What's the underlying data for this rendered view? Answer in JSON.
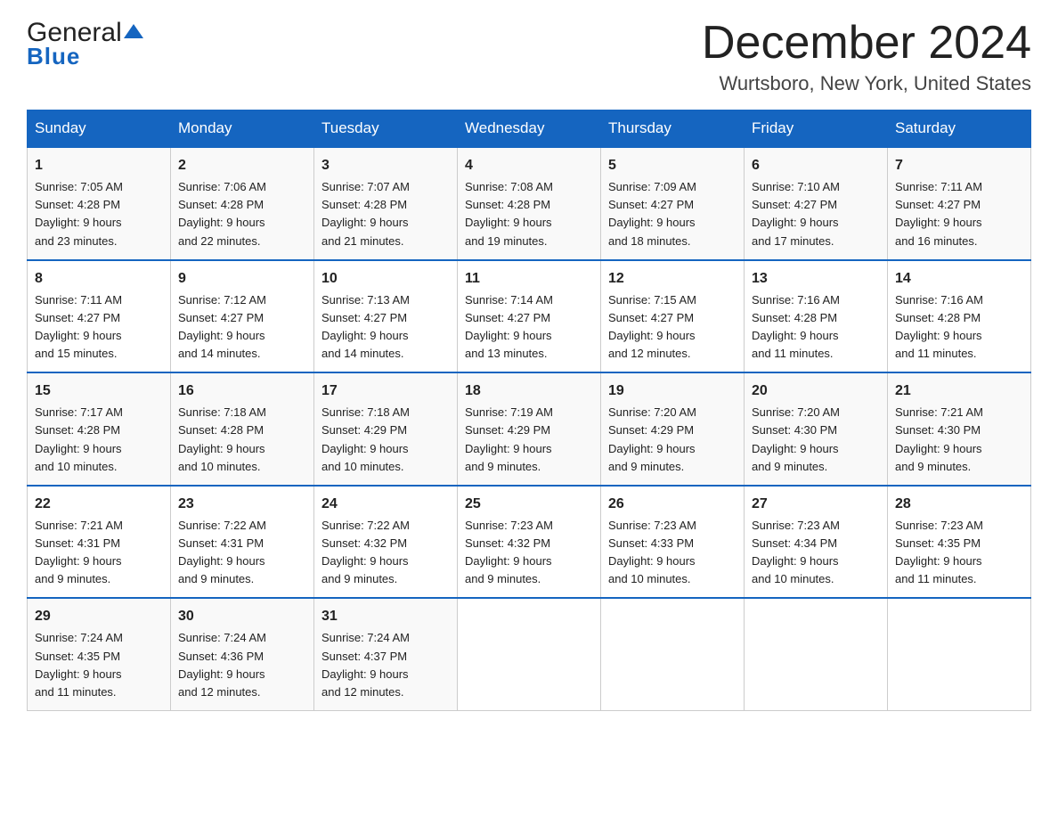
{
  "logo": {
    "general": "General",
    "blue": "Blue",
    "triangle_aria": "triangle"
  },
  "header": {
    "month_title": "December 2024",
    "location": "Wurtsboro, New York, United States"
  },
  "days_of_week": [
    "Sunday",
    "Monday",
    "Tuesday",
    "Wednesday",
    "Thursday",
    "Friday",
    "Saturday"
  ],
  "weeks": [
    [
      {
        "num": "1",
        "sunrise": "7:05 AM",
        "sunset": "4:28 PM",
        "daylight": "9 hours and 23 minutes."
      },
      {
        "num": "2",
        "sunrise": "7:06 AM",
        "sunset": "4:28 PM",
        "daylight": "9 hours and 22 minutes."
      },
      {
        "num": "3",
        "sunrise": "7:07 AM",
        "sunset": "4:28 PM",
        "daylight": "9 hours and 21 minutes."
      },
      {
        "num": "4",
        "sunrise": "7:08 AM",
        "sunset": "4:28 PM",
        "daylight": "9 hours and 19 minutes."
      },
      {
        "num": "5",
        "sunrise": "7:09 AM",
        "sunset": "4:27 PM",
        "daylight": "9 hours and 18 minutes."
      },
      {
        "num": "6",
        "sunrise": "7:10 AM",
        "sunset": "4:27 PM",
        "daylight": "9 hours and 17 minutes."
      },
      {
        "num": "7",
        "sunrise": "7:11 AM",
        "sunset": "4:27 PM",
        "daylight": "9 hours and 16 minutes."
      }
    ],
    [
      {
        "num": "8",
        "sunrise": "7:11 AM",
        "sunset": "4:27 PM",
        "daylight": "9 hours and 15 minutes."
      },
      {
        "num": "9",
        "sunrise": "7:12 AM",
        "sunset": "4:27 PM",
        "daylight": "9 hours and 14 minutes."
      },
      {
        "num": "10",
        "sunrise": "7:13 AM",
        "sunset": "4:27 PM",
        "daylight": "9 hours and 14 minutes."
      },
      {
        "num": "11",
        "sunrise": "7:14 AM",
        "sunset": "4:27 PM",
        "daylight": "9 hours and 13 minutes."
      },
      {
        "num": "12",
        "sunrise": "7:15 AM",
        "sunset": "4:27 PM",
        "daylight": "9 hours and 12 minutes."
      },
      {
        "num": "13",
        "sunrise": "7:16 AM",
        "sunset": "4:28 PM",
        "daylight": "9 hours and 11 minutes."
      },
      {
        "num": "14",
        "sunrise": "7:16 AM",
        "sunset": "4:28 PM",
        "daylight": "9 hours and 11 minutes."
      }
    ],
    [
      {
        "num": "15",
        "sunrise": "7:17 AM",
        "sunset": "4:28 PM",
        "daylight": "9 hours and 10 minutes."
      },
      {
        "num": "16",
        "sunrise": "7:18 AM",
        "sunset": "4:28 PM",
        "daylight": "9 hours and 10 minutes."
      },
      {
        "num": "17",
        "sunrise": "7:18 AM",
        "sunset": "4:29 PM",
        "daylight": "9 hours and 10 minutes."
      },
      {
        "num": "18",
        "sunrise": "7:19 AM",
        "sunset": "4:29 PM",
        "daylight": "9 hours and 9 minutes."
      },
      {
        "num": "19",
        "sunrise": "7:20 AM",
        "sunset": "4:29 PM",
        "daylight": "9 hours and 9 minutes."
      },
      {
        "num": "20",
        "sunrise": "7:20 AM",
        "sunset": "4:30 PM",
        "daylight": "9 hours and 9 minutes."
      },
      {
        "num": "21",
        "sunrise": "7:21 AM",
        "sunset": "4:30 PM",
        "daylight": "9 hours and 9 minutes."
      }
    ],
    [
      {
        "num": "22",
        "sunrise": "7:21 AM",
        "sunset": "4:31 PM",
        "daylight": "9 hours and 9 minutes."
      },
      {
        "num": "23",
        "sunrise": "7:22 AM",
        "sunset": "4:31 PM",
        "daylight": "9 hours and 9 minutes."
      },
      {
        "num": "24",
        "sunrise": "7:22 AM",
        "sunset": "4:32 PM",
        "daylight": "9 hours and 9 minutes."
      },
      {
        "num": "25",
        "sunrise": "7:23 AM",
        "sunset": "4:32 PM",
        "daylight": "9 hours and 9 minutes."
      },
      {
        "num": "26",
        "sunrise": "7:23 AM",
        "sunset": "4:33 PM",
        "daylight": "9 hours and 10 minutes."
      },
      {
        "num": "27",
        "sunrise": "7:23 AM",
        "sunset": "4:34 PM",
        "daylight": "9 hours and 10 minutes."
      },
      {
        "num": "28",
        "sunrise": "7:23 AM",
        "sunset": "4:35 PM",
        "daylight": "9 hours and 11 minutes."
      }
    ],
    [
      {
        "num": "29",
        "sunrise": "7:24 AM",
        "sunset": "4:35 PM",
        "daylight": "9 hours and 11 minutes."
      },
      {
        "num": "30",
        "sunrise": "7:24 AM",
        "sunset": "4:36 PM",
        "daylight": "9 hours and 12 minutes."
      },
      {
        "num": "31",
        "sunrise": "7:24 AM",
        "sunset": "4:37 PM",
        "daylight": "9 hours and 12 minutes."
      },
      null,
      null,
      null,
      null
    ]
  ],
  "labels": {
    "sunrise": "Sunrise: ",
    "sunset": "Sunset: ",
    "daylight": "Daylight: "
  }
}
